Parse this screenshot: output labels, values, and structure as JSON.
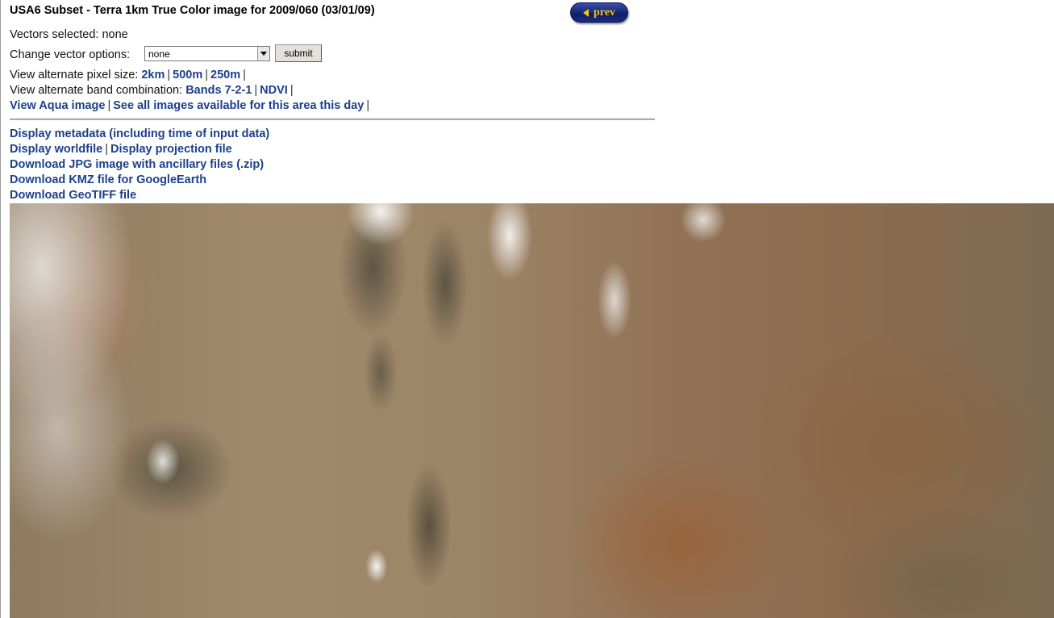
{
  "page": {
    "title": "USA6 Subset - Terra 1km True Color image for 2009/060 (03/01/09)"
  },
  "nav": {
    "prev_label": "prev"
  },
  "vectors": {
    "selected_label": "Vectors selected:",
    "selected_value": "none",
    "change_label": "Change vector options:",
    "select_value": "none",
    "submit_label": "submit"
  },
  "pixel_size": {
    "label": "View alternate pixel size:",
    "links": [
      "2km",
      "500m",
      "250m"
    ]
  },
  "band_combo": {
    "label": "View alternate band combination:",
    "links": [
      "Bands 7-2-1",
      "NDVI"
    ]
  },
  "alt_views": {
    "aqua": "View Aqua image",
    "all_images": "See all images available for this area this day"
  },
  "downloads": {
    "metadata": "Display metadata (including time of input data)",
    "worldfile": "Display worldfile",
    "projection": "Display projection file",
    "jpg": "Download JPG image with ancillary files (.zip)",
    "kmz": "Download KMZ file for GoogleEarth",
    "geotiff": "Download GeoTIFF file"
  },
  "separator": "|"
}
